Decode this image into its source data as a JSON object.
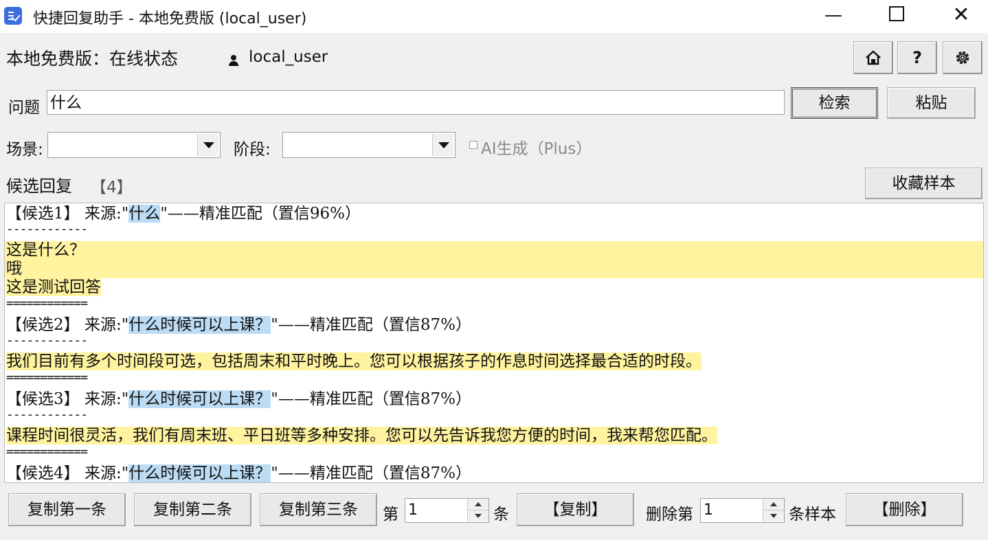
{
  "window": {
    "title": "快捷回复助手 - 本地免费版 (local_user)",
    "minimize": "—",
    "close": "✕"
  },
  "status": {
    "edition": "本地免费版",
    "separator": "：",
    "state": "在线状态",
    "username": "local_user"
  },
  "toolbar": {
    "home_icon": "home-icon",
    "help_label": "?",
    "settings_icon": "gear-icon"
  },
  "question": {
    "label": "问题",
    "value": "什么",
    "search_button": "检索",
    "paste_button": "粘贴"
  },
  "filters": {
    "scene_label": "场景:",
    "scene_value": "",
    "stage_label": "阶段:",
    "stage_value": "",
    "ai_label": "AI生成（Plus）",
    "ai_checked": false
  },
  "candidates": {
    "title": "候选回复",
    "count": "【4】",
    "favorite_button": "收藏样本",
    "items": [
      {
        "header": "【候选1】 来源:",
        "open_quote": "\"",
        "source": "什么",
        "close_quote": "\"",
        "match": "——精准匹配（置信96%）",
        "dash_sep": "------------",
        "lines": [
          "这是什么？",
          "哦",
          "这是测试回答"
        ],
        "end_sep": "============"
      },
      {
        "header": "【候选2】 来源:",
        "open_quote": "\"",
        "source": "什么时候可以上课？",
        "close_quote": "\"",
        "match": "——精准匹配（置信87%）",
        "dash_sep": "------------",
        "lines": [
          "我们目前有多个时间段可选，包括周末和平时晚上。您可以根据孩子的作息时间选择最合适的时段。"
        ],
        "end_sep": "============"
      },
      {
        "header": "【候选3】 来源:",
        "open_quote": "\"",
        "source": "什么时候可以上课？",
        "close_quote": "\"",
        "match": "——精准匹配（置信87%）",
        "dash_sep": "------------",
        "lines": [
          "课程时间很灵活，我们有周末班、平日班等多种安排。您可以先告诉我您方便的时间，我来帮您匹配。"
        ],
        "end_sep": "============"
      },
      {
        "header": "【候选4】 来源:",
        "open_quote": "\"",
        "source": "什么时候可以上课？",
        "close_quote": "\"",
        "match": "——精准匹配（置信87%）"
      }
    ]
  },
  "actions": {
    "copy_first": "复制第一条",
    "copy_second": "复制第二条",
    "copy_third": "复制第三条",
    "nth_prefix": "第",
    "nth_value": "1",
    "nth_suffix": "条",
    "copy_button": "【复制】",
    "delete_prefix": "删除第",
    "delete_value": "1",
    "delete_suffix": "条样本",
    "delete_button": "【删除】"
  }
}
